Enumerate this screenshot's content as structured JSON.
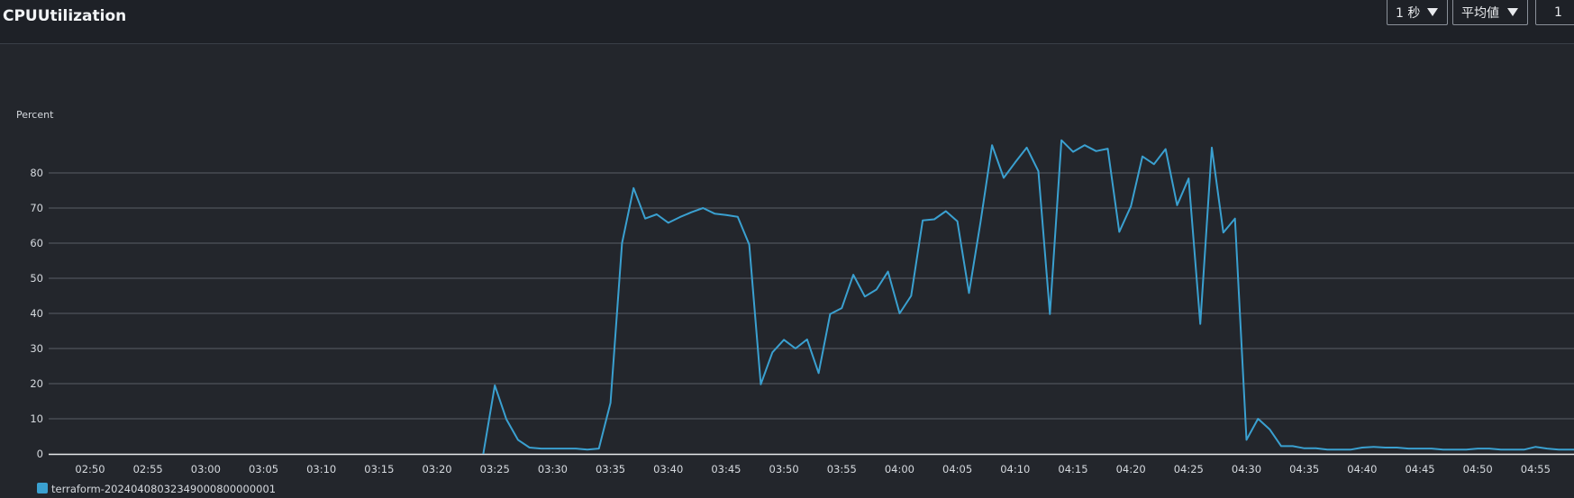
{
  "header": {
    "title": "CPUUtilization",
    "period": "1 秒",
    "statistic": "平均値",
    "extra": "1"
  },
  "colors": {
    "series": "#3aa0d0",
    "grid": "#5a5f66",
    "axis": "#e8eaed"
  },
  "chart_data": {
    "type": "line",
    "title": "CPUUtilization",
    "xlabel": "",
    "ylabel": "Percent",
    "ylim": [
      0,
      90
    ],
    "yticks": [
      0,
      10,
      20,
      30,
      40,
      50,
      60,
      70,
      80
    ],
    "xticks": [
      "02:50",
      "02:55",
      "03:00",
      "03:05",
      "03:10",
      "03:15",
      "03:20",
      "03:25",
      "03:30",
      "03:35",
      "03:40",
      "03:45",
      "03:50",
      "03:55",
      "04:00",
      "04:05",
      "04:10",
      "04:15",
      "04:20",
      "04:25",
      "04:30",
      "04:35",
      "04:40",
      "04:45",
      "04:50",
      "04:55"
    ],
    "grid": true,
    "legend": "bottom-left",
    "series": [
      {
        "name": "terraform-20240408032349000800000001",
        "x_minutes": [
          204,
          205,
          206,
          207,
          208,
          209,
          210,
          211,
          212,
          213,
          214,
          215,
          216,
          217,
          218,
          219,
          220,
          221,
          222,
          223,
          224,
          225,
          226,
          227,
          228,
          229,
          230,
          231,
          232,
          233,
          234,
          235,
          236,
          237,
          238,
          239,
          240,
          241,
          242,
          243,
          244,
          245,
          246,
          247,
          248,
          249,
          250,
          251,
          252,
          253,
          254,
          255,
          256,
          257,
          258,
          259,
          260,
          261,
          262,
          263,
          264,
          265,
          266,
          267,
          268,
          269,
          270,
          271,
          272,
          273,
          274,
          275,
          276,
          277,
          278,
          279,
          280,
          281,
          282,
          283,
          284,
          285,
          286,
          287,
          288,
          289,
          290,
          291,
          292,
          293,
          294,
          295,
          296,
          297,
          298,
          299
        ],
        "y": [
          0,
          19.5,
          9.8,
          4,
          1.8,
          1.5,
          1.5,
          1.5,
          1.5,
          1.2,
          1.5,
          14.5,
          60,
          75.7,
          67,
          68.2,
          65.8,
          67.4,
          68.8,
          70,
          68.4,
          68,
          67.5,
          59.6,
          19.8,
          28.9,
          32.5,
          30,
          32.6,
          23,
          39.8,
          41.5,
          51,
          44.8,
          46.8,
          51.9,
          40,
          45,
          66.5,
          66.8,
          69.1,
          66.2,
          45.8,
          66,
          87.9,
          78.6,
          83,
          87.2,
          80.5,
          39.8,
          89.3,
          86,
          87.9,
          86.2,
          86.9,
          63.2,
          70.5,
          84.7,
          82.5,
          86.8,
          70.8,
          78.4,
          37,
          87.2,
          63,
          67,
          4,
          10,
          7,
          2.2,
          2.2,
          1.6,
          1.6,
          1.2,
          1.2,
          1.2,
          1.8,
          2,
          1.8,
          1.8,
          1.5,
          1.5,
          1.5,
          1.2,
          1.2,
          1.2,
          1.5,
          1.5,
          1.2,
          1.2,
          1.2,
          2,
          1.5,
          1.2,
          1.2,
          1.2
        ]
      }
    ]
  }
}
